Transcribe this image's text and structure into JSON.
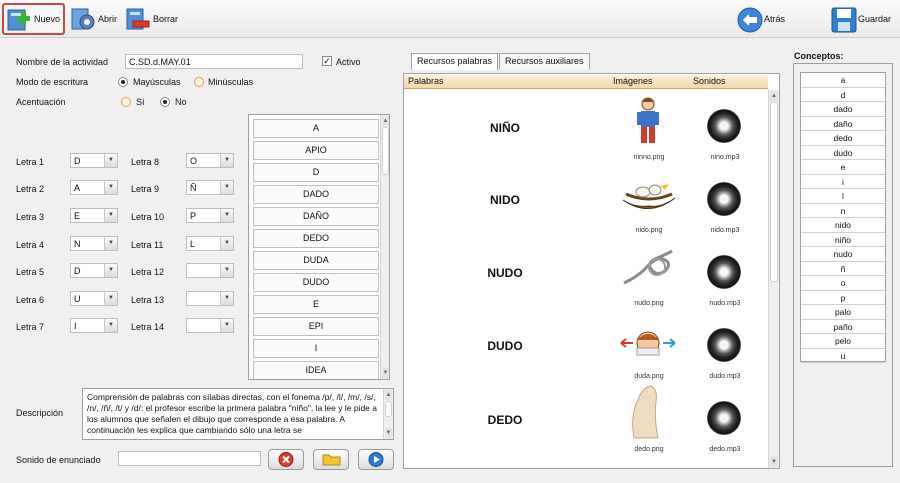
{
  "toolbar": {
    "nuevo": "Nuevo",
    "abrir": "Abrir",
    "borrar": "Borrar",
    "atras": "Atrás",
    "guardar": "Guardar"
  },
  "form": {
    "nombre_label": "Nombre de la actividad",
    "nombre_value": "C.SD.d.MAY.01",
    "activo_label": "Activo",
    "modo_label": "Modo de escritura",
    "mayusculas": "Mayúsculas",
    "minusculas": "Minúsculas",
    "acentuacion_label": "Acentuación",
    "si": "Sí",
    "no": "No",
    "descripcion_label": "Descripción",
    "descripcion_text": "Comprensión de palabras con sílabas directas, con el fonema /p/, /l/, /m/, /s/, /n/, /ñ/, /t/ y /d/: el profesor escribe la primera palabra \"niño\", la lee y le pide a los alumnos que señalen el dibujo que corresponde a esa palabra. A continuación les explica que cambiando sólo una letra se",
    "sonido_label": "Sonido de enunciado"
  },
  "letters": [
    {
      "label": "Letra 1",
      "value": "D"
    },
    {
      "label": "Letra 2",
      "value": "A"
    },
    {
      "label": "Letra 3",
      "value": "E"
    },
    {
      "label": "Letra 4",
      "value": "N"
    },
    {
      "label": "Letra 5",
      "value": "D"
    },
    {
      "label": "Letra 6",
      "value": "U"
    },
    {
      "label": "Letra 7",
      "value": "I"
    },
    {
      "label": "Letra 8",
      "value": "O"
    },
    {
      "label": "Letra 9",
      "value": "Ñ"
    },
    {
      "label": "Letra 10",
      "value": "P"
    },
    {
      "label": "Letra 11",
      "value": "L"
    },
    {
      "label": "Letra 12",
      "value": ""
    },
    {
      "label": "Letra 13",
      "value": ""
    },
    {
      "label": "Letra 14",
      "value": ""
    }
  ],
  "wordlist": [
    "A",
    "APIO",
    "D",
    "DADO",
    "DAÑO",
    "DEDO",
    "DUDA",
    "DUDO",
    "E",
    "EPI",
    "I",
    "IDEA"
  ],
  "tabs": [
    "Recursos palabras",
    "Recursos auxiliares"
  ],
  "resources": {
    "headers": [
      "Palabras",
      "Imágenes",
      "Sonidos"
    ],
    "rows": [
      {
        "word": "NIÑO",
        "image": "ninno.png",
        "sound": "nino.mp3"
      },
      {
        "word": "NIDO",
        "image": "nido.png",
        "sound": "nido.mp3"
      },
      {
        "word": "NUDO",
        "image": "nudo.png",
        "sound": "nudo.mp3"
      },
      {
        "word": "DUDO",
        "image": "duda.png",
        "sound": "dudo.mp3"
      },
      {
        "word": "DEDO",
        "image": "dedo.png",
        "sound": "dedo.mp3"
      }
    ]
  },
  "concepts": {
    "title": "Conceptos:",
    "items": [
      "a",
      "d",
      "dado",
      "daño",
      "dedo",
      "dudo",
      "e",
      "i",
      "l",
      "n",
      "nido",
      "niño",
      "nudo",
      "ñ",
      "o",
      "p",
      "palo",
      "paño",
      "pelo",
      "u"
    ]
  }
}
